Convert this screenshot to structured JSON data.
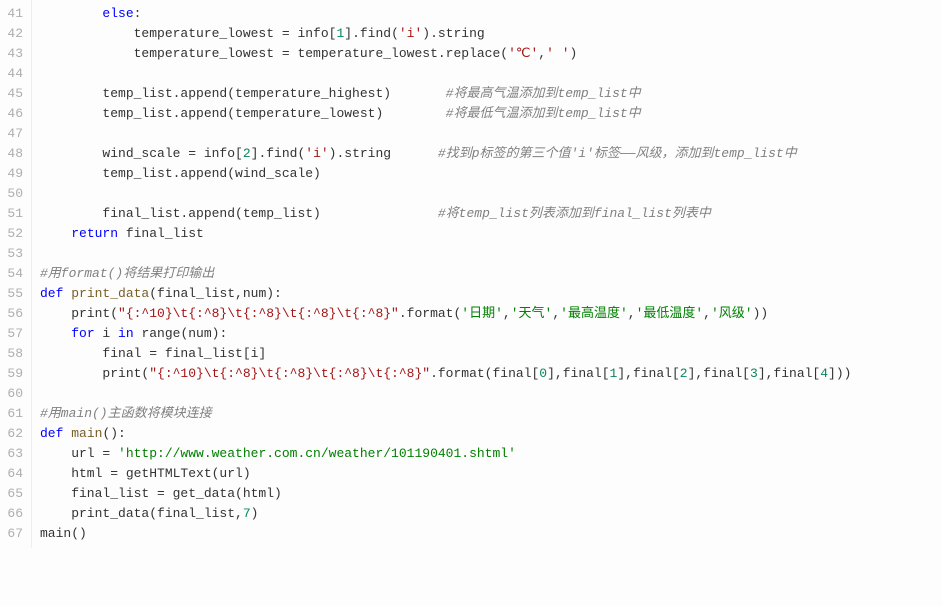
{
  "startLine": 41,
  "lines": [
    {
      "tokens": [
        {
          "t": "        ",
          "c": "id"
        },
        {
          "t": "else",
          "c": "kw"
        },
        {
          "t": ":",
          "c": "op"
        }
      ]
    },
    {
      "tokens": [
        {
          "t": "            temperature_lowest = info[",
          "c": "id"
        },
        {
          "t": "1",
          "c": "num"
        },
        {
          "t": "].find(",
          "c": "id"
        },
        {
          "t": "'i'",
          "c": "str"
        },
        {
          "t": ").string",
          "c": "id"
        }
      ]
    },
    {
      "tokens": [
        {
          "t": "            temperature_lowest = temperature_lowest.replace(",
          "c": "id"
        },
        {
          "t": "'℃'",
          "c": "str"
        },
        {
          "t": ",",
          "c": "op"
        },
        {
          "t": "' '",
          "c": "str"
        },
        {
          "t": ")",
          "c": "id"
        }
      ]
    },
    {
      "tokens": [
        {
          "t": "",
          "c": "id"
        }
      ]
    },
    {
      "tokens": [
        {
          "t": "        temp_list.append(temperature_highest)       ",
          "c": "id"
        },
        {
          "t": "#将最高气温添加到temp_list中",
          "c": "cmt"
        }
      ]
    },
    {
      "tokens": [
        {
          "t": "        temp_list.append(temperature_lowest)        ",
          "c": "id"
        },
        {
          "t": "#将最低气温添加到temp_list中",
          "c": "cmt"
        }
      ]
    },
    {
      "tokens": [
        {
          "t": "",
          "c": "id"
        }
      ]
    },
    {
      "tokens": [
        {
          "t": "        wind_scale = info[",
          "c": "id"
        },
        {
          "t": "2",
          "c": "num"
        },
        {
          "t": "].find(",
          "c": "id"
        },
        {
          "t": "'i'",
          "c": "str"
        },
        {
          "t": ").string      ",
          "c": "id"
        },
        {
          "t": "#找到p标签的第三个值'i'标签——风级，添加到temp_list中",
          "c": "cmt"
        }
      ]
    },
    {
      "tokens": [
        {
          "t": "        temp_list.append(wind_scale)",
          "c": "id"
        }
      ]
    },
    {
      "tokens": [
        {
          "t": "",
          "c": "id"
        }
      ]
    },
    {
      "tokens": [
        {
          "t": "        final_list.append(temp_list)               ",
          "c": "id"
        },
        {
          "t": "#将temp_list列表添加到final_list列表中",
          "c": "cmt"
        }
      ]
    },
    {
      "tokens": [
        {
          "t": "    ",
          "c": "id"
        },
        {
          "t": "return",
          "c": "kw"
        },
        {
          "t": " final_list",
          "c": "id"
        }
      ]
    },
    {
      "tokens": [
        {
          "t": "",
          "c": "id"
        }
      ]
    },
    {
      "tokens": [
        {
          "t": "#用format()将结果打印输出",
          "c": "cmt"
        }
      ]
    },
    {
      "tokens": [
        {
          "t": "def",
          "c": "kw"
        },
        {
          "t": " ",
          "c": "id"
        },
        {
          "t": "print_data",
          "c": "fn"
        },
        {
          "t": "(final_list,num):",
          "c": "id"
        }
      ]
    },
    {
      "tokens": [
        {
          "t": "    print(",
          "c": "id"
        },
        {
          "t": "\"{:^10}\\t{:^8}\\t{:^8}\\t{:^8}\\t{:^8}\"",
          "c": "str"
        },
        {
          "t": ".format(",
          "c": "id"
        },
        {
          "t": "'日期'",
          "c": "gstr"
        },
        {
          "t": ",",
          "c": "op"
        },
        {
          "t": "'天气'",
          "c": "gstr"
        },
        {
          "t": ",",
          "c": "op"
        },
        {
          "t": "'最高温度'",
          "c": "gstr"
        },
        {
          "t": ",",
          "c": "op"
        },
        {
          "t": "'最低温度'",
          "c": "gstr"
        },
        {
          "t": ",",
          "c": "op"
        },
        {
          "t": "'风级'",
          "c": "gstr"
        },
        {
          "t": "))",
          "c": "id"
        }
      ]
    },
    {
      "tokens": [
        {
          "t": "    ",
          "c": "id"
        },
        {
          "t": "for",
          "c": "kw"
        },
        {
          "t": " i ",
          "c": "id"
        },
        {
          "t": "in",
          "c": "kw"
        },
        {
          "t": " range(num):",
          "c": "id"
        }
      ]
    },
    {
      "tokens": [
        {
          "t": "        final = final_list[i]",
          "c": "id"
        }
      ]
    },
    {
      "tokens": [
        {
          "t": "        print(",
          "c": "id"
        },
        {
          "t": "\"{:^10}\\t{:^8}\\t{:^8}\\t{:^8}\\t{:^8}\"",
          "c": "str"
        },
        {
          "t": ".format(final[",
          "c": "id"
        },
        {
          "t": "0",
          "c": "num"
        },
        {
          "t": "],final[",
          "c": "id"
        },
        {
          "t": "1",
          "c": "num"
        },
        {
          "t": "],final[",
          "c": "id"
        },
        {
          "t": "2",
          "c": "num"
        },
        {
          "t": "],final[",
          "c": "id"
        },
        {
          "t": "3",
          "c": "num"
        },
        {
          "t": "],final[",
          "c": "id"
        },
        {
          "t": "4",
          "c": "num"
        },
        {
          "t": "]))",
          "c": "id"
        }
      ]
    },
    {
      "tokens": [
        {
          "t": "",
          "c": "id"
        }
      ]
    },
    {
      "tokens": [
        {
          "t": "#用main()主函数将模块连接",
          "c": "cmt"
        }
      ]
    },
    {
      "tokens": [
        {
          "t": "def",
          "c": "kw"
        },
        {
          "t": " ",
          "c": "id"
        },
        {
          "t": "main",
          "c": "fn"
        },
        {
          "t": "():",
          "c": "id"
        }
      ]
    },
    {
      "tokens": [
        {
          "t": "    url = ",
          "c": "id"
        },
        {
          "t": "'http://www.weather.com.cn/weather/101190401.shtml'",
          "c": "gstr"
        }
      ]
    },
    {
      "tokens": [
        {
          "t": "    html = getHTMLText(url)",
          "c": "id"
        }
      ]
    },
    {
      "tokens": [
        {
          "t": "    final_list = get_data(html)",
          "c": "id"
        }
      ]
    },
    {
      "tokens": [
        {
          "t": "    print_data(final_list,",
          "c": "id"
        },
        {
          "t": "7",
          "c": "num"
        },
        {
          "t": ")",
          "c": "id"
        }
      ]
    },
    {
      "tokens": [
        {
          "t": "main()",
          "c": "id"
        }
      ]
    }
  ]
}
